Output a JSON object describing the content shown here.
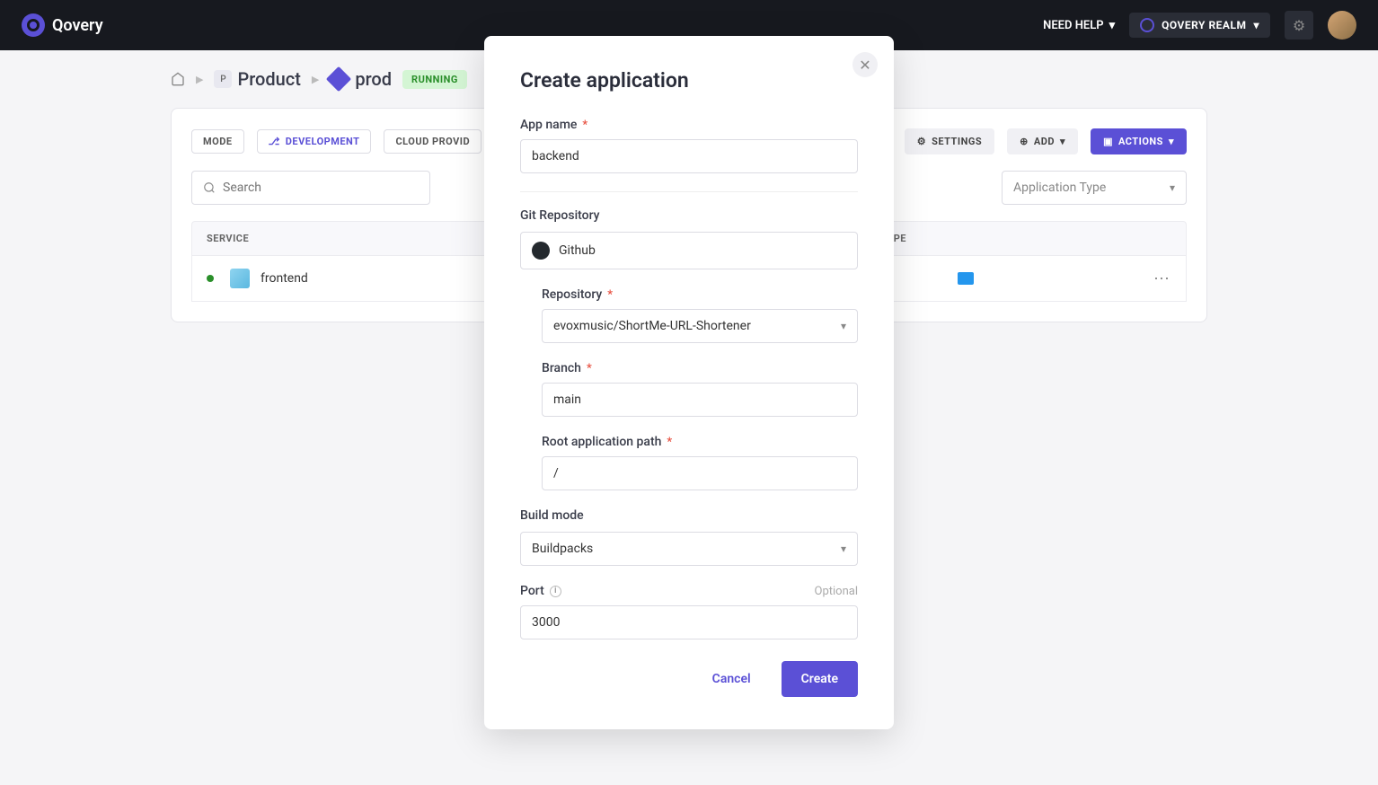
{
  "header": {
    "brand": "Qovery",
    "help_label": "NEED HELP",
    "realm_label": "QOVERY REALM"
  },
  "breadcrumb": {
    "project": "Product",
    "project_badge": "P",
    "env": "prod",
    "status": "RUNNING"
  },
  "toolbar": {
    "mode_label": "MODE",
    "dev_label": "DEVELOPMENT",
    "cloud_label": "CLOUD PROVID",
    "settings_label": "SETTINGS",
    "add_label": "ADD",
    "actions_label": "ACTIONS"
  },
  "filters": {
    "search_placeholder": "Search",
    "type_placeholder": "Application Type"
  },
  "table": {
    "col_service": "SERVICE",
    "col_type": "TYPE",
    "rows": [
      {
        "name": "frontend"
      }
    ]
  },
  "modal": {
    "title": "Create application",
    "app_name_label": "App name",
    "app_name_value": "backend",
    "git_section": "Git Repository",
    "provider": "Github",
    "repo_label": "Repository",
    "repo_value": "evoxmusic/ShortMe-URL-Shortener",
    "branch_label": "Branch",
    "branch_value": "main",
    "root_label": "Root application path",
    "root_value": "/",
    "build_label": "Build mode",
    "build_value": "Buildpacks",
    "port_label": "Port",
    "port_optional": "Optional",
    "port_value": "3000",
    "cancel": "Cancel",
    "create": "Create"
  }
}
